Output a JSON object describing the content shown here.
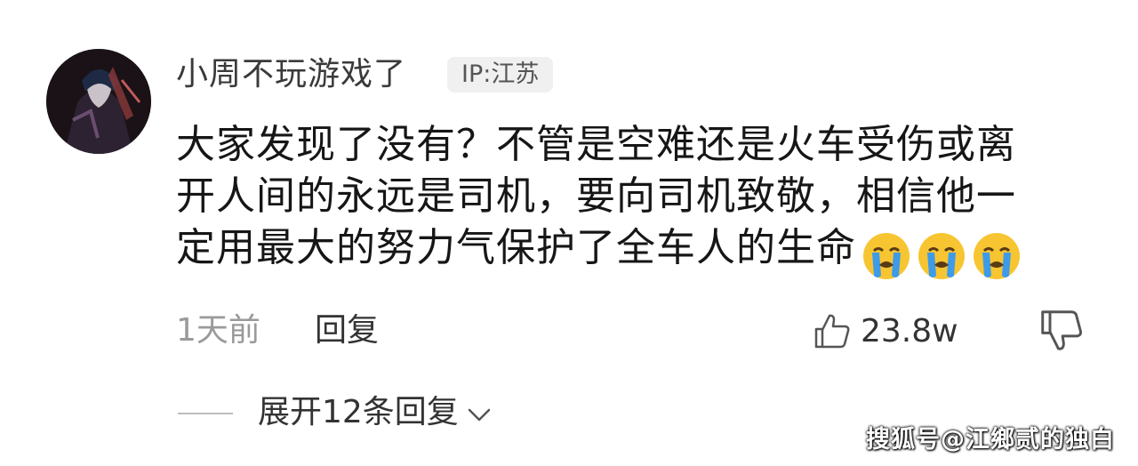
{
  "comment": {
    "author": "小周不玩游戏了",
    "ip_label": "IP:江苏",
    "text_lines": [
      "大家发现了没有？不管是空难还是火车受伤或离",
      "开人间的永远是司机，要向司机致敬，相信他一",
      "定用最大的努力气保护了全车人的生命"
    ],
    "emoji": [
      "crying-emoji",
      "crying-emoji",
      "crying-emoji"
    ],
    "time": "1天前",
    "reply_label": "回复",
    "like_count": "23.8w",
    "expand_label": "展开12条回复"
  },
  "watermark": "搜狐号@江鄉贰的独白",
  "colors": {
    "background": "#ffffff",
    "text": "#161616",
    "muted": "#9a9a9a",
    "tag_bg": "#f0f0f0",
    "emoji_face": "#f7c531",
    "emoji_tears": "#3d9be9"
  }
}
